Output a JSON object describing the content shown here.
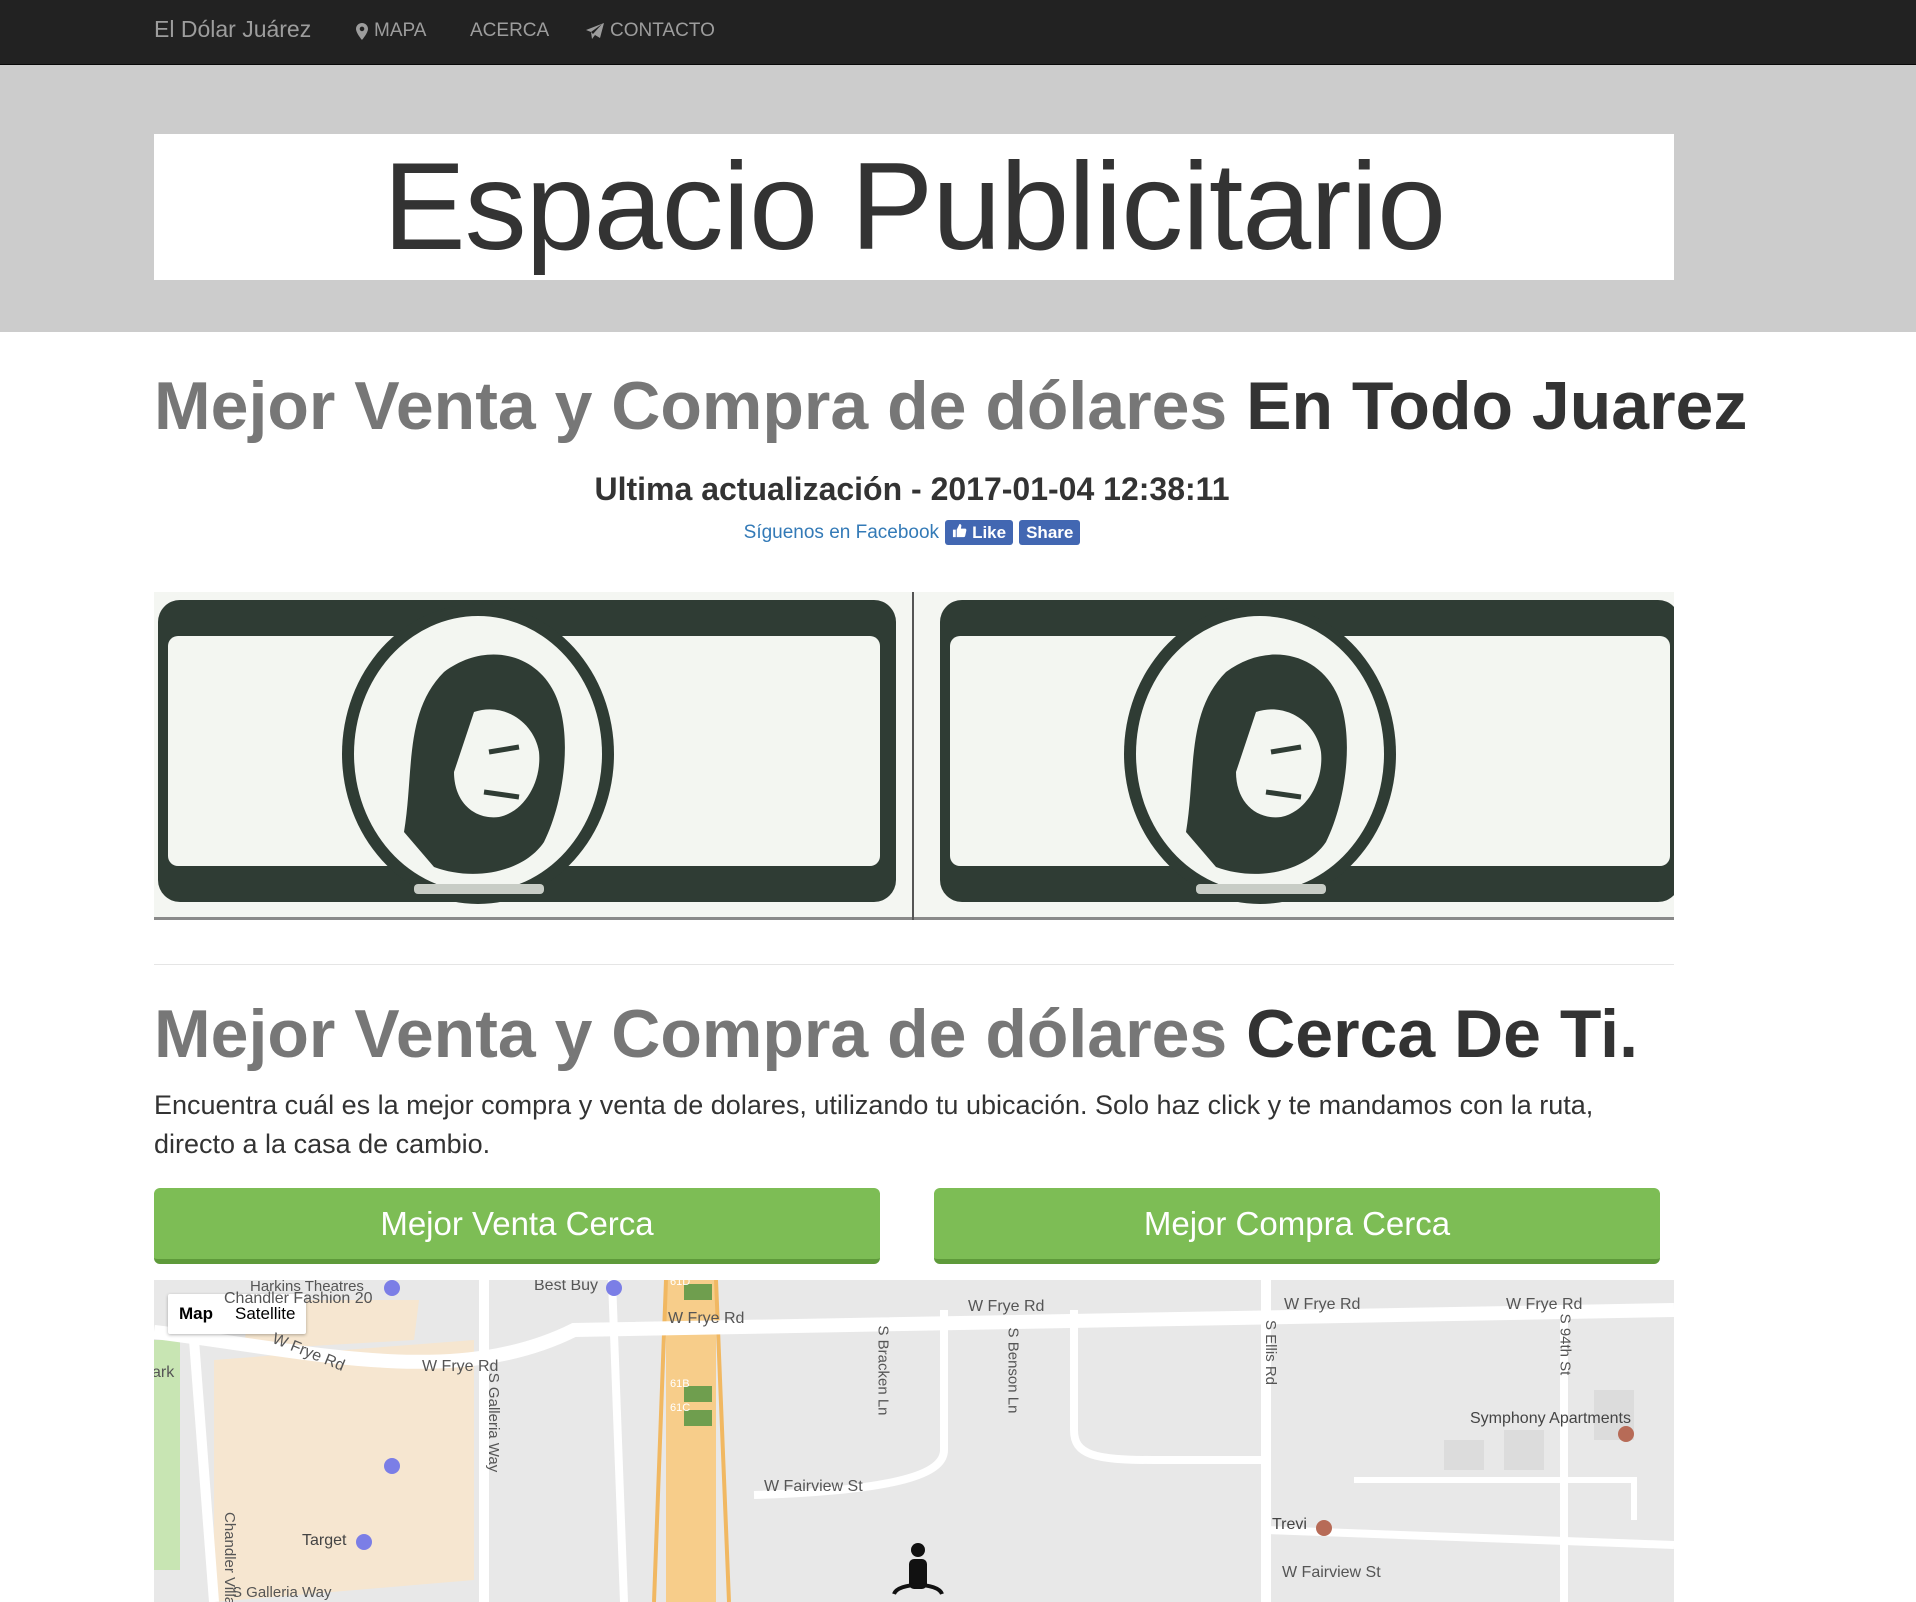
{
  "nav": {
    "brand": "El Dólar Juárez",
    "items": [
      {
        "label": "MAPA",
        "icon": "map-marker-icon"
      },
      {
        "label": "ACERCA",
        "icon": ""
      },
      {
        "label": "CONTACTO",
        "icon": "paper-plane-icon"
      }
    ]
  },
  "ad": {
    "text": "Espacio Publicitario"
  },
  "main": {
    "heading_muted": "Mejor Venta y Compra de dólares",
    "heading_strong": "En Todo Juarez",
    "update": "Ultima actualización - 2017-01-04 12:38:11",
    "facebook": {
      "link": "Síguenos en Facebook",
      "like": "Like",
      "share": "Share"
    }
  },
  "near": {
    "heading_muted": "Mejor Venta y Compra de dólares",
    "heading_strong": "Cerca De Ti.",
    "lead": "Encuentra cuál es la mejor compra y venta de dolares, utilizando tu ubicación. Solo haz click y te mandamos con la ruta, directo a la casa de cambio.",
    "btn_sell": "Mejor Venta Cerca",
    "btn_buy": "Mejor Compra Cerca"
  },
  "map": {
    "toggle": {
      "map": "Map",
      "satellite": "Satellite"
    },
    "labels": {
      "harkins": "Harkins Theatres",
      "chandler_fashion": "Chandler Fashion 20",
      "best_buy": "Best Buy",
      "frye_a": "W Frye Rd",
      "frye_b": "W Frye Rd",
      "frye_c": "W Frye Rd",
      "frye_d": "W Frye Rd",
      "frye_e": "W Frye Rd",
      "frye_f": "W Frye Rd",
      "galleria_way": "S Galleria Way",
      "galleria_way_b": "S Galleria Way",
      "bracken": "S Bracken Ln",
      "benson": "S Benson Ln",
      "ellis": "S Ellis Rd",
      "ninety_fourth": "S 94th St",
      "symphony": "Symphony Apartments",
      "fairview_a": "W Fairview St",
      "fairview_b": "W Fairview St",
      "trevi": "Trevi",
      "target": "Target",
      "chandler_village": "Chandler Village",
      "park": "ark",
      "exit_61d": "61D",
      "exit_61b": "61B",
      "exit_61c": "61C"
    }
  }
}
